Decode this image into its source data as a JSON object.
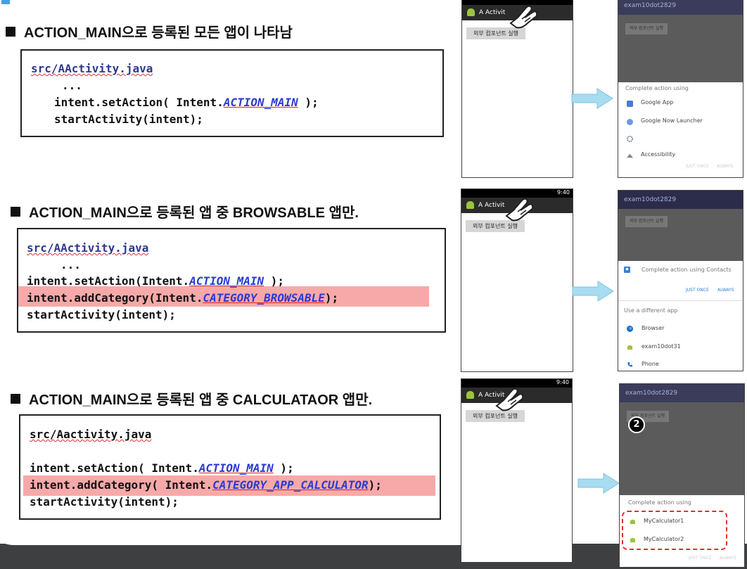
{
  "sections": [
    {
      "heading": "ACTION_MAIN으로 등록된 모든 앱이 나타남",
      "code": {
        "file": "src/AActivity.java",
        "ellipsis": "...",
        "line1_pre": "intent.setAction( Intent.",
        "line1_const": "ACTION_MAIN",
        "line1_post": " );",
        "line2": "startActivity(intent);"
      },
      "phone": {
        "title": "A Activit",
        "button": "외부 컴포넌트 실행",
        "time": ""
      },
      "dialog": {
        "title": "exam10dot2829",
        "button": "외부 컴포넌트 실행",
        "header": "Complete action using",
        "items": [
          "Google App",
          "Google Now Launcher",
          "",
          "Accessibility"
        ],
        "just_once": "JUST ONCE",
        "always": "ALWAYS"
      }
    },
    {
      "heading": "ACTION_MAIN으로 등록된 앱 중 BROWSABLE 앱만.",
      "code": {
        "file": "src/AActivity.java",
        "ellipsis": "...",
        "line1_pre": "intent.setAction(Intent.",
        "line1_const": "ACTION_MAIN",
        "line1_post": " );",
        "line2_pre": "intent.addCategory(Intent.",
        "line2_const": "CATEGORY_BROWSABLE",
        "line2_post": ");",
        "line3": "startActivity(intent);"
      },
      "phone": {
        "title": "A Activit",
        "button": "외부 컴포넌트 실행",
        "time": "9:40"
      },
      "dialog": {
        "title": "exam10dot2829",
        "button": "외부 컴포넌트 실행",
        "header": "Complete action using Contacts",
        "just_once": "JUST ONCE",
        "always": "ALWAYS",
        "subheader": "Use a different app",
        "items": [
          "Browser",
          "exam10dot31",
          "Phone"
        ]
      }
    },
    {
      "heading": "ACTION_MAIN으로 등록된 앱 중 CALCULATAOR 앱만.",
      "code": {
        "file": "src/Aactivity.java",
        "line1_pre": "intent.setAction( Intent.",
        "line1_const": "ACTION_MAIN",
        "line1_post": " );",
        "line2_pre": "intent.addCategory( Intent.",
        "line2_const": "CATEGORY_APP_CALCULATOR",
        "line2_post": ");",
        "line3": "startActivity(intent);"
      },
      "phone": {
        "title": "A Activit",
        "button": "외부 컴포넌트 실행",
        "time": "9:40"
      },
      "dialog": {
        "title": "exam10dot2829",
        "button": "외부 컴포넌트 실행",
        "badge": "2",
        "header": "Complete action using",
        "items": [
          "MyCalculator1",
          "MyCalculator2"
        ],
        "just_once": "JUST ONCE",
        "always": "ALWAYS"
      }
    }
  ],
  "colors": {
    "highlight": "#f7a9a9",
    "arrow": "#a8dcf0",
    "dashed": "#e03030",
    "dialog_title_bg": "#2a2c4a"
  }
}
